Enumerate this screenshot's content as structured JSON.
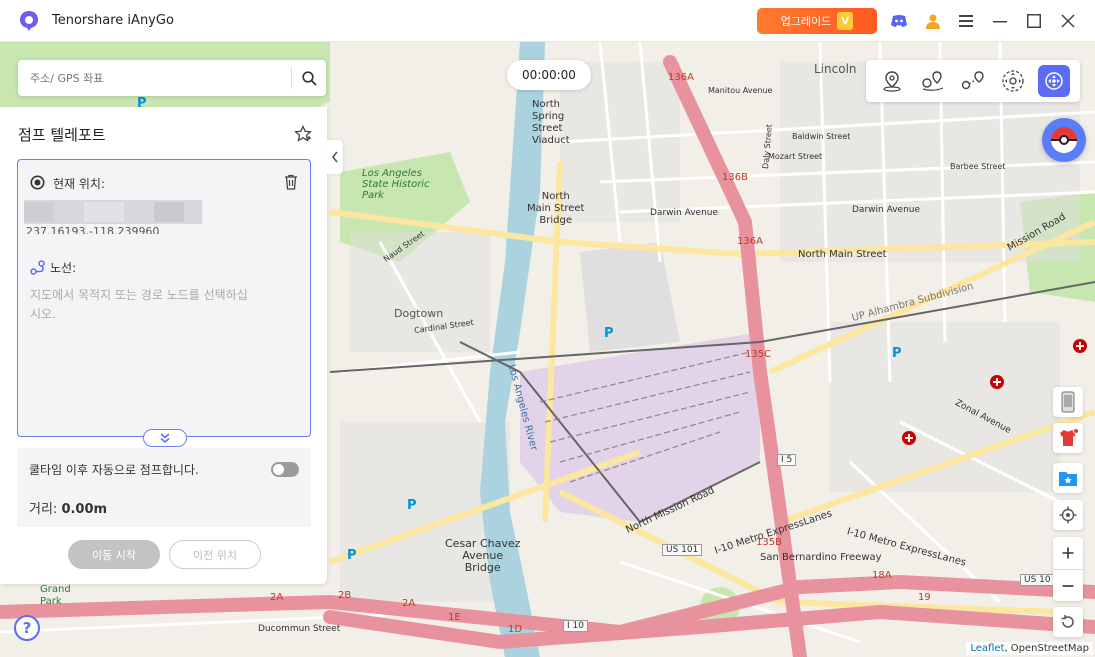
{
  "app": {
    "title": "Tenorshare iAnyGo",
    "upgrade_label": "업그레이드",
    "upgrade_badge": "V"
  },
  "search": {
    "placeholder": "주소/ GPS 좌표"
  },
  "timer": {
    "value": "00:00:00"
  },
  "panel": {
    "title": "점프 텔레포트",
    "current_location_label": "현재 위치:",
    "coords_partial": "237.16193,-118.239960",
    "route_label": "노선:",
    "route_hint": "지도에서 목적지 또는 경로 노드를 선택하십시오.",
    "auto_jump_label": "쿨타임 이후 자동으로 점프합니다.",
    "auto_jump_on": false,
    "distance_label": "거리:",
    "distance_value": "0.00m",
    "move_button": "이동 시작",
    "prev_button": "이전 위치"
  },
  "map": {
    "attribution_link": "Leaflet",
    "attribution_text": "OpenStreetMap",
    "labels": {
      "lincoln": "Lincoln",
      "north_spring": "North\nSpring\nStreet\nViaduct",
      "la_state_park": "Los Angeles\nState Historic\nPark",
      "north_main_bridge": "North\nMain Street\nBridge",
      "dogtown": "Dogtown",
      "cesar_chavez": "Cesar Chavez\nAvenue\nBridge",
      "grand_park": "Grand\nPark",
      "north_main_street": "North Main Street",
      "darwin_avenue": "Darwin Avenue",
      "mission_road": "Mission Road",
      "north_mission_road": "North Mission Road",
      "zonal_avenue": "Zonal Avenue",
      "alhambra": "UP Alhambra Subdivision",
      "manitou": "Manitou Avenue",
      "baldwin": "Baldwin Street",
      "mozart": "Mozart Street",
      "barbee": "Barbee Street",
      "la_river": "Los Angeles River",
      "i10_express": "I-10 Metro ExpressLanes",
      "sb_freeway": "San Bernardino Freeway",
      "ducommun": "Ducommun Street",
      "cardinal": "Cardinal Street",
      "naud": "Naud Street",
      "daly": "Daly Street",
      "ramp_136a": "136A",
      "ramp_136b": "136B",
      "ramp_135c": "135C",
      "ramp_135b": "135B",
      "ramp_18a": "18A",
      "ramp_19": "19",
      "ramp_2a": "2A",
      "ramp_2b": "2B",
      "ramp_1e": "1E",
      "ramp_1d": "1D",
      "us101": "US 101",
      "us101b": "US 10",
      "i5": "I 5",
      "i10": "I 10",
      "parking1": "P",
      "parking2": "P",
      "parking3": "P",
      "parking4": "P",
      "parking5": "P"
    }
  },
  "colors": {
    "accent": "#5b6cf9",
    "upgrade": "#ff6a26",
    "motorway": "#e8929e",
    "primary_road": "#fbe79f",
    "park": "#c8e6b0",
    "water": "#aad3df",
    "rail": "#e3d3e8"
  },
  "icons": {
    "mode_teleport": "map-pin-icon",
    "mode_two_spot": "two-spot-icon",
    "mode_multi_spot": "multi-spot-icon",
    "mode_joystick": "joystick-icon",
    "mode_game": "gamepad-icon"
  }
}
